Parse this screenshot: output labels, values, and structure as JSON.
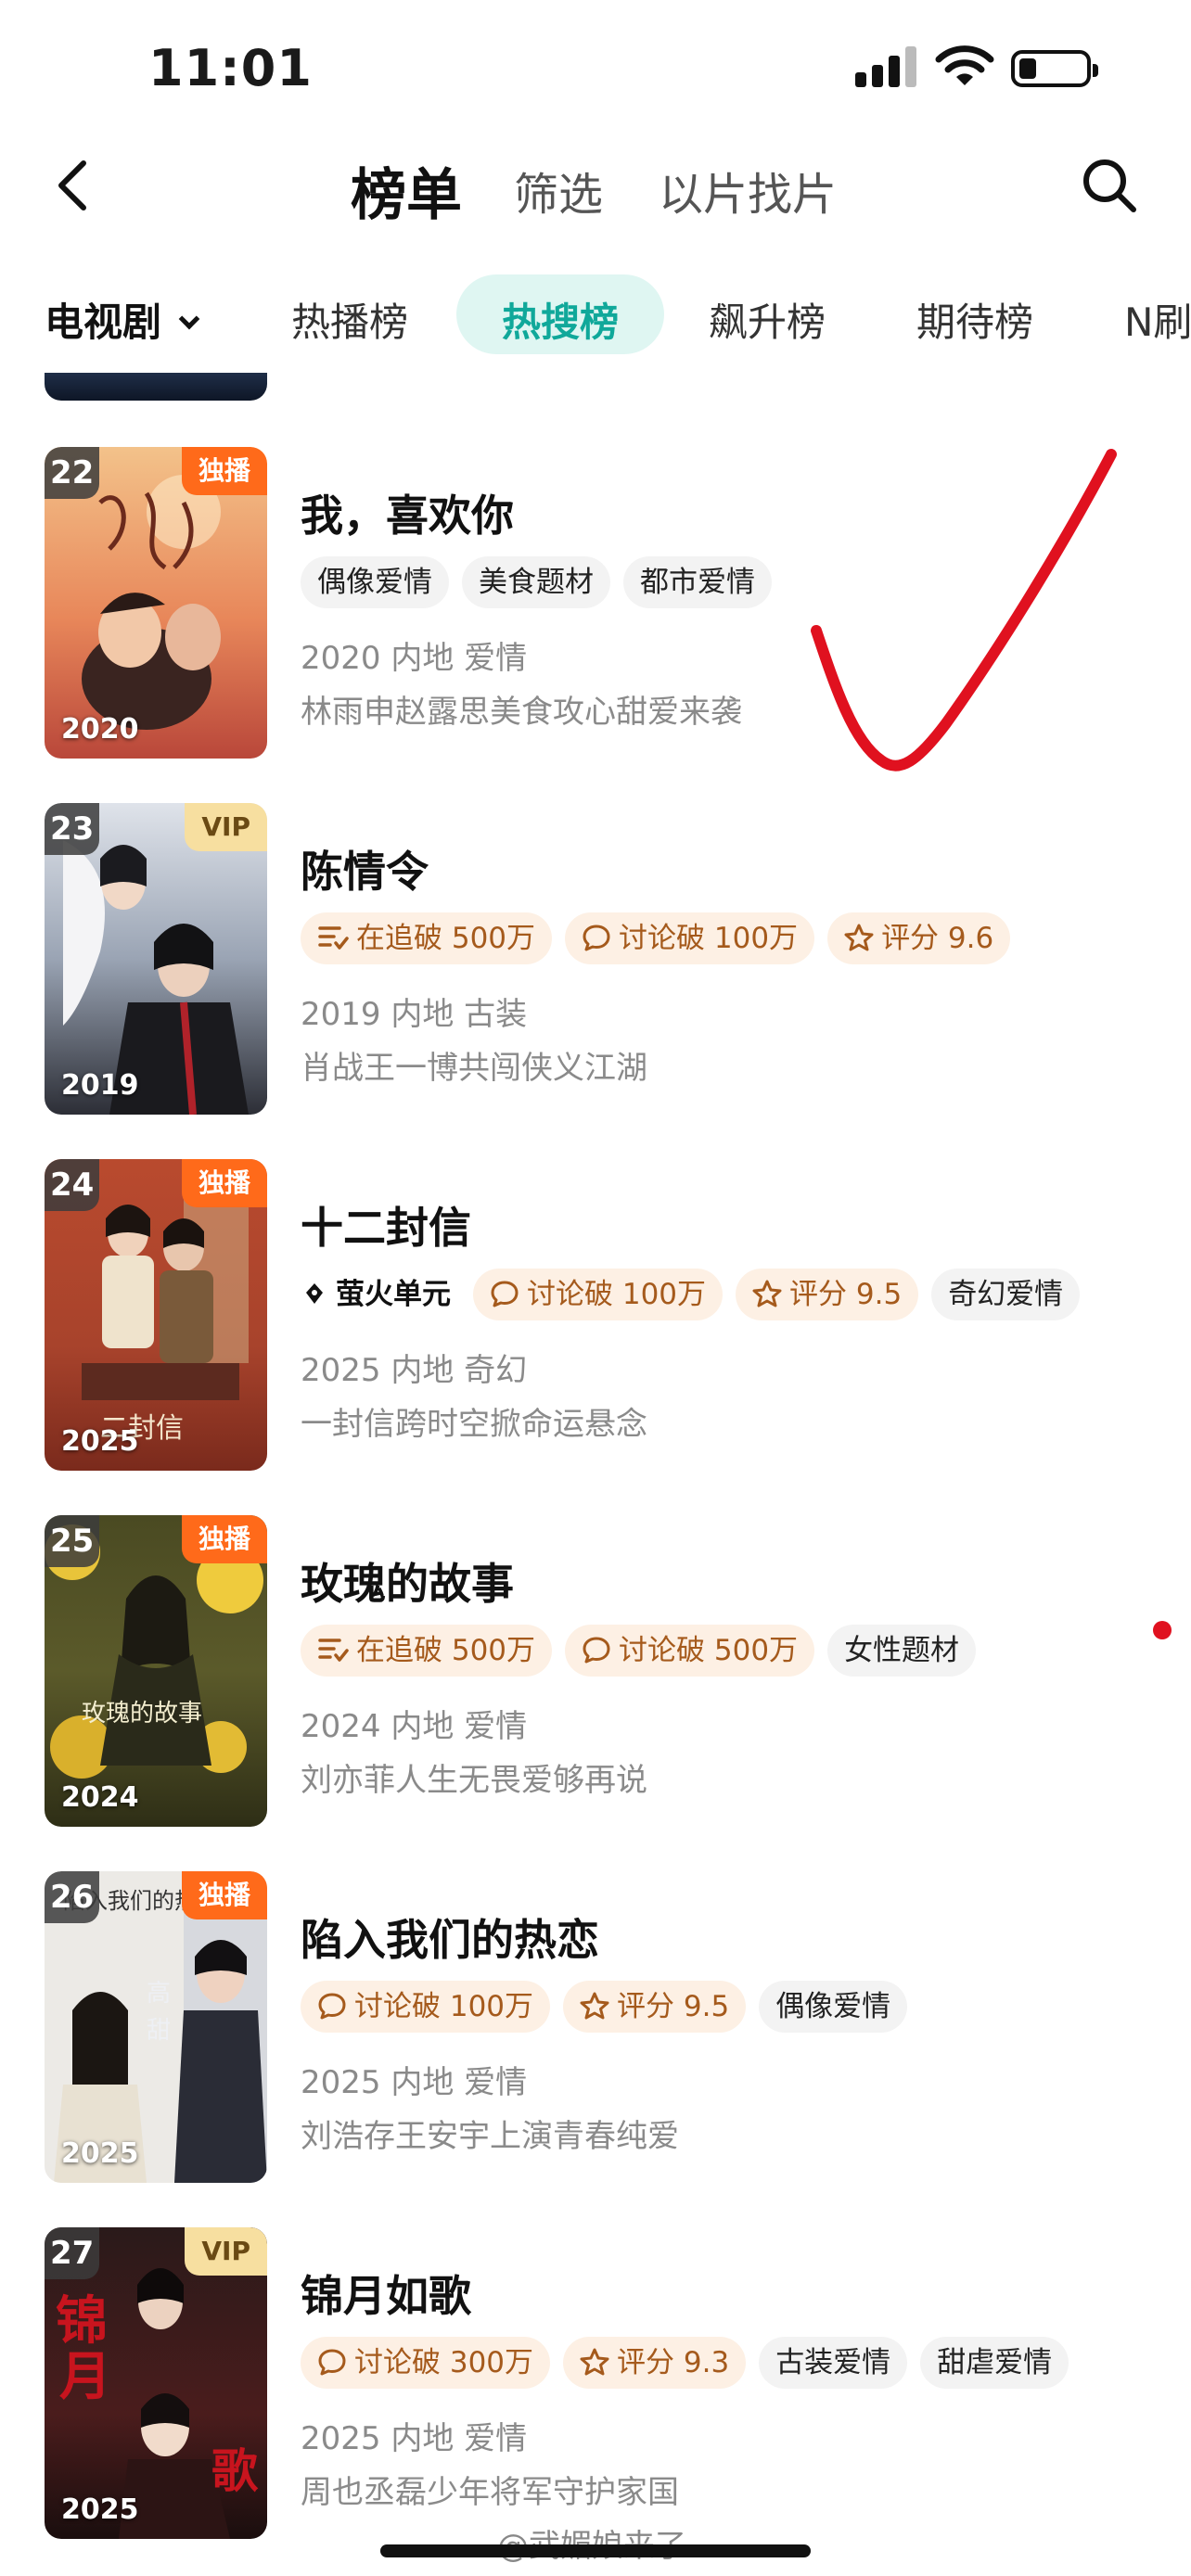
{
  "status_bar": {
    "time": "11:01"
  },
  "nav": {
    "title": "榜单",
    "filter_label": "筛选",
    "find_label": "以片找片"
  },
  "tabs": {
    "genre": "电视剧",
    "items": [
      "热播榜",
      "热搜榜",
      "飙升榜",
      "期待榜",
      "N刷"
    ],
    "active": "热搜榜"
  },
  "colors": {
    "accent": "#10a89a",
    "exclusive_badge": "#ff6a1a",
    "vip_badge": "#f7dfa0",
    "annotation_red": "#e0111f"
  },
  "items": [
    {
      "rank": "22",
      "badge": "独播",
      "badge_type": "exclusive",
      "poster_year": "2020",
      "title": "我，喜欢你",
      "tags": [
        {
          "text": "偶像爱情",
          "kind": "plain"
        },
        {
          "text": "美食题材",
          "kind": "plain"
        },
        {
          "text": "都市爱情",
          "kind": "plain"
        }
      ],
      "meta": "2020 内地 爱情",
      "desc": "林雨申赵露思美食攻心甜爱来袭"
    },
    {
      "rank": "23",
      "badge": "VIP",
      "badge_type": "vip",
      "poster_year": "2019",
      "title": "陈情令",
      "tags": [
        {
          "text": "在追破 500万",
          "kind": "hot",
          "icon": "follow-icon"
        },
        {
          "text": "讨论破 100万",
          "kind": "hot",
          "icon": "comment-icon"
        },
        {
          "text": "评分 9.6",
          "kind": "hot",
          "icon": "star-icon"
        }
      ],
      "meta": "2019 内地 古装",
      "desc": "肖战王一博共闯侠义江湖"
    },
    {
      "rank": "24",
      "badge": "独播",
      "badge_type": "exclusive",
      "poster_year": "2025",
      "title": "十二封信",
      "tags": [
        {
          "text": "萤火单元",
          "kind": "brand",
          "icon": "firefly-icon"
        },
        {
          "text": "讨论破 100万",
          "kind": "hot",
          "icon": "comment-icon"
        },
        {
          "text": "评分 9.5",
          "kind": "hot",
          "icon": "star-icon"
        },
        {
          "text": "奇幻爱情",
          "kind": "plain"
        }
      ],
      "meta": "2025 内地 奇幻",
      "desc": "一封信跨时空掀命运悬念"
    },
    {
      "rank": "25",
      "badge": "独播",
      "badge_type": "exclusive",
      "poster_year": "2024",
      "title": "玫瑰的故事",
      "tags": [
        {
          "text": "在追破 500万",
          "kind": "hot",
          "icon": "follow-icon"
        },
        {
          "text": "讨论破 500万",
          "kind": "hot",
          "icon": "comment-icon"
        },
        {
          "text": "女性题材",
          "kind": "plain"
        }
      ],
      "meta": "2024 内地 爱情",
      "desc": "刘亦菲人生无畏爱够再说"
    },
    {
      "rank": "26",
      "badge": "独播",
      "badge_type": "exclusive",
      "poster_year": "2025",
      "title": "陷入我们的热恋",
      "tags": [
        {
          "text": "讨论破 100万",
          "kind": "hot",
          "icon": "comment-icon"
        },
        {
          "text": "评分 9.5",
          "kind": "hot",
          "icon": "star-icon"
        },
        {
          "text": "偶像爱情",
          "kind": "plain"
        }
      ],
      "meta": "2025 内地 爱情",
      "desc": "刘浩存王安宇上演青春纯爱"
    },
    {
      "rank": "27",
      "badge": "VIP",
      "badge_type": "vip",
      "poster_year": "2025",
      "title": "锦月如歌",
      "tags": [
        {
          "text": "讨论破 300万",
          "kind": "hot",
          "icon": "comment-icon"
        },
        {
          "text": "评分 9.3",
          "kind": "hot",
          "icon": "star-icon"
        },
        {
          "text": "古装爱情",
          "kind": "plain"
        },
        {
          "text": "甜虐爱情",
          "kind": "plain"
        }
      ],
      "meta": "2025 内地 爱情",
      "desc": "周也丞磊少年将军守护家国"
    }
  ],
  "watermark": "@武媚娘来了"
}
